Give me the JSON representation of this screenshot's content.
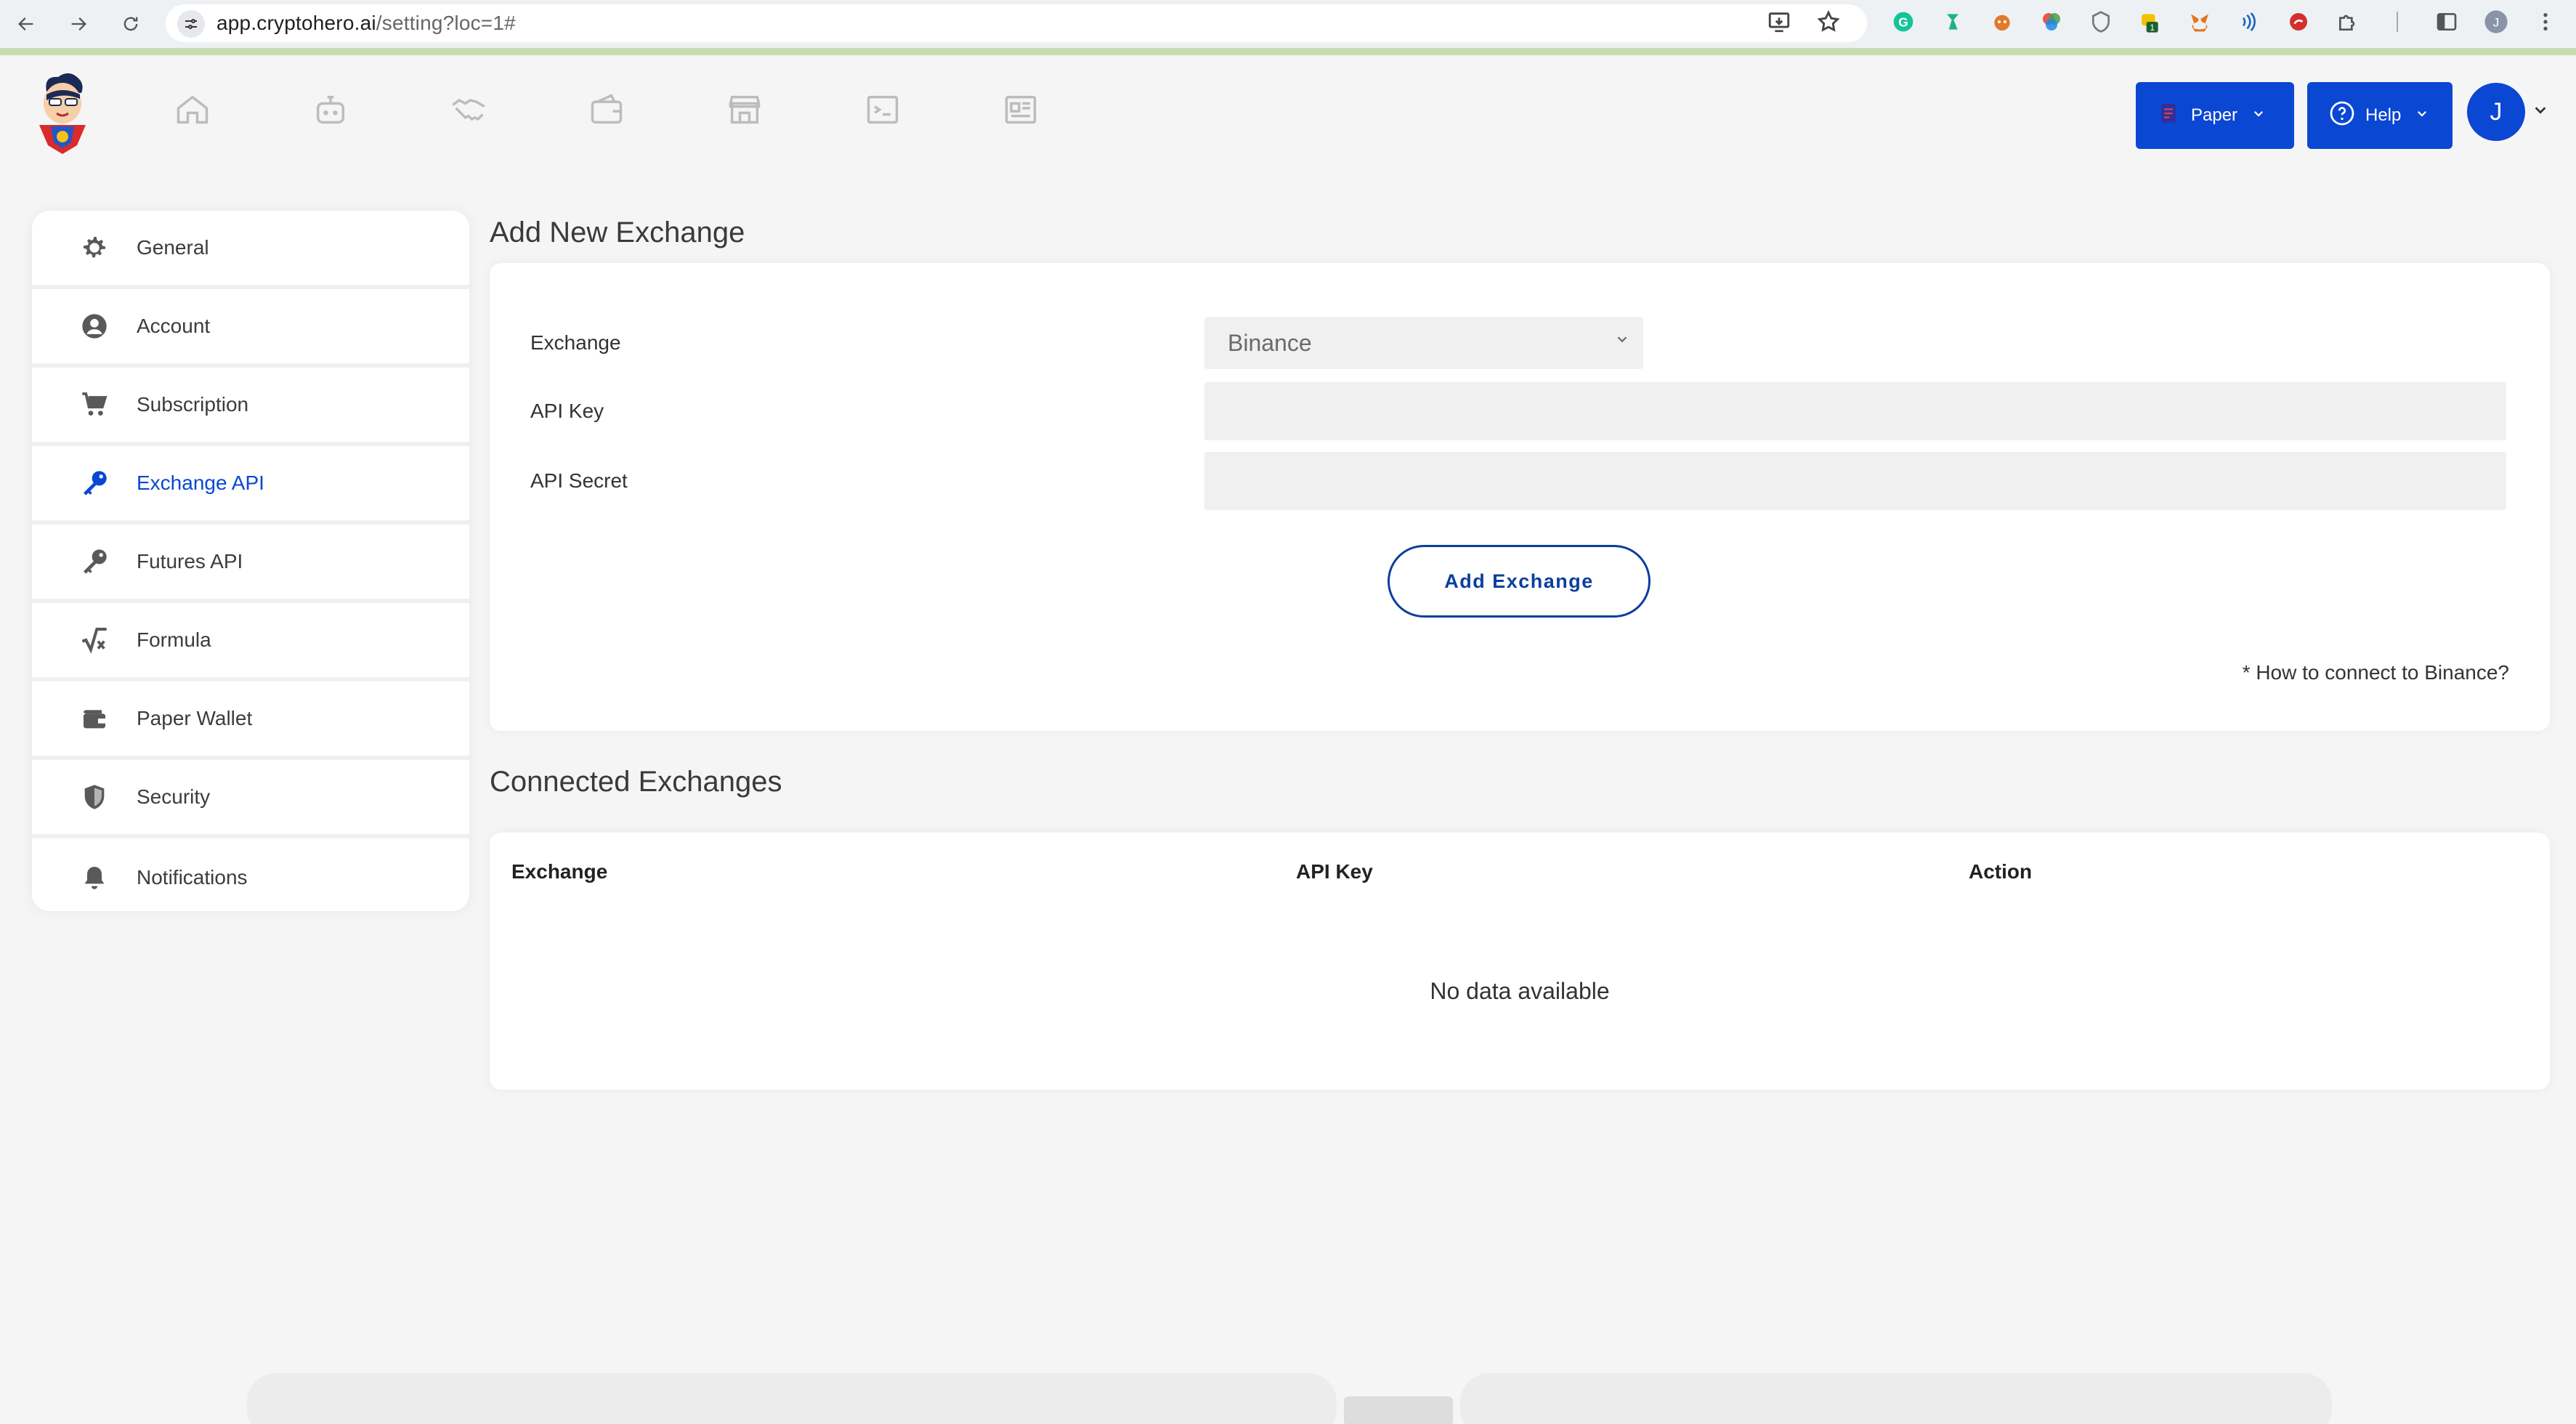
{
  "browser": {
    "url_host": "app.cryptohero.ai",
    "url_path": "/setting?loc=1#"
  },
  "header": {
    "paper_label": "Paper",
    "help_label": "Help",
    "avatar_initial": "J"
  },
  "sidebar": {
    "items": [
      {
        "label": "General"
      },
      {
        "label": "Account"
      },
      {
        "label": "Subscription"
      },
      {
        "label": "Exchange API"
      },
      {
        "label": "Futures API"
      },
      {
        "label": "Formula"
      },
      {
        "label": "Paper Wallet"
      },
      {
        "label": "Security"
      },
      {
        "label": "Notifications"
      }
    ],
    "active_color": "#0a47d3"
  },
  "add_exchange": {
    "title": "Add New Exchange",
    "exchange_label": "Exchange",
    "exchange_value": "Binance",
    "api_key_label": "API Key",
    "api_key_value": "",
    "api_secret_label": "API Secret",
    "api_secret_value": "",
    "button_label": "Add Exchange",
    "help_link": "* How to connect to Binance?"
  },
  "connected": {
    "title": "Connected Exchanges",
    "columns": [
      "Exchange",
      "API Key",
      "Action"
    ],
    "empty_message": "No data available"
  },
  "colors": {
    "brand_blue": "#0a47d3",
    "button_outline": "#0a3f9c",
    "page_bg": "#f5f5f5"
  }
}
